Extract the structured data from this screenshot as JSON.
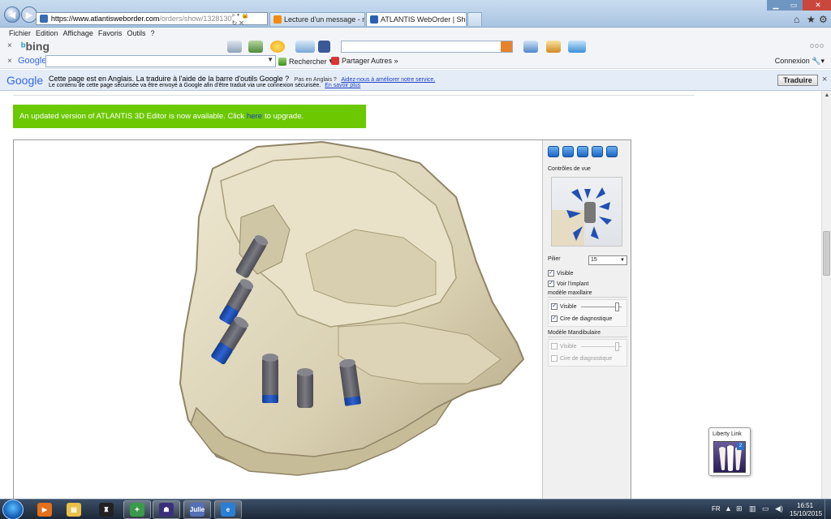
{
  "browser": {
    "address": {
      "host": "https://www.atlantisweborder.com",
      "path": "/orders/show/1328130"
    },
    "tabs": [
      {
        "label": "Lecture d'un message - mail O...",
        "active": false,
        "icon_color": "#f28a0c"
      },
      {
        "label": "ATLANTIS WebOrder | Sho...",
        "active": true,
        "icon_color": "#2b5fb3"
      }
    ],
    "menu": [
      "Fichier",
      "Edition",
      "Affichage",
      "Favoris",
      "Outils",
      "?"
    ]
  },
  "bing_toolbar": {
    "logo": "bing",
    "close": "×",
    "more": "ooo"
  },
  "google_toolbar": {
    "logo": "Google",
    "close": "×",
    "search_label": "Rechercher",
    "share_label": "Partager",
    "more_label": "Autres »",
    "connexion_label": "Connexion"
  },
  "translate_bar": {
    "logo": "Google",
    "line1": "Cette page est en Anglais. La traduire à l'aide de la barre d'outils Google ?",
    "not_english": "Pas en Anglais ?",
    "help_link": "Aidez-nous à améliorer notre service.",
    "line2": "Le contenu de cette page sécurisée va être envoyé à Google afin d'être traduit via une connexion sécurisée.",
    "learn_more": "En savoir plus",
    "translate_button": "Traduire",
    "close": "×"
  },
  "upgrade_banner": {
    "text_before": "An updated version of ATLANTIS 3D Editor is now available. Click",
    "link": "here",
    "text_after": "to upgrade.",
    "color": "#6cc800"
  },
  "panel": {
    "view_controls_title": "Contrôles de vue",
    "pilier_label": "Pilier",
    "pilier_value": "15",
    "visible_label": "Visible",
    "voir_implant_label": "Voir l'implant",
    "maxillaire_group": "modèle maxillaire",
    "maxillaire_visible": "Visible",
    "maxillaire_cire": "Cire de diagnostique",
    "mandibulaire_group": "Modèle Mandibulaire",
    "mandibulaire_visible": "Visible",
    "mandibulaire_cire": "Cire de diagnostique",
    "checks": {
      "visible": true,
      "voir_implant": true,
      "maxillaire_visible": true,
      "maxillaire_cire": true,
      "mandibulaire_visible": false,
      "mandibulaire_cire": false
    }
  },
  "liberty_link": {
    "label": "Liberty Link",
    "badge": "2"
  },
  "taskbar": {
    "apps": [
      {
        "name": "media-player-icon",
        "glyph": "▶",
        "color": "#e56f1a",
        "open": false
      },
      {
        "name": "folder-icon",
        "glyph": "▤",
        "color": "#e8c04a",
        "open": false
      },
      {
        "name": "hat-app-icon",
        "glyph": "♜",
        "color": "#222",
        "open": false
      },
      {
        "name": "network-app-icon",
        "glyph": "✦",
        "color": "#3a9a4a",
        "open": true
      },
      {
        "name": "tooth-app-icon",
        "glyph": "☗",
        "color": "#3a2f7a",
        "open": true
      },
      {
        "name": "julie-app-icon",
        "glyph": "Julie",
        "color": "#5470b6",
        "open": true
      },
      {
        "name": "ie-icon",
        "glyph": "e",
        "color": "#2a7fd4",
        "open": true
      }
    ],
    "language": "FR",
    "time": "16:51",
    "date": "15/10/2015"
  },
  "colors": {
    "implant_gray": "#6b6b72",
    "implant_blue": "#1c4fb6",
    "scan_ivory": "#ddd4b8",
    "scan_shadow": "#8f8465"
  }
}
